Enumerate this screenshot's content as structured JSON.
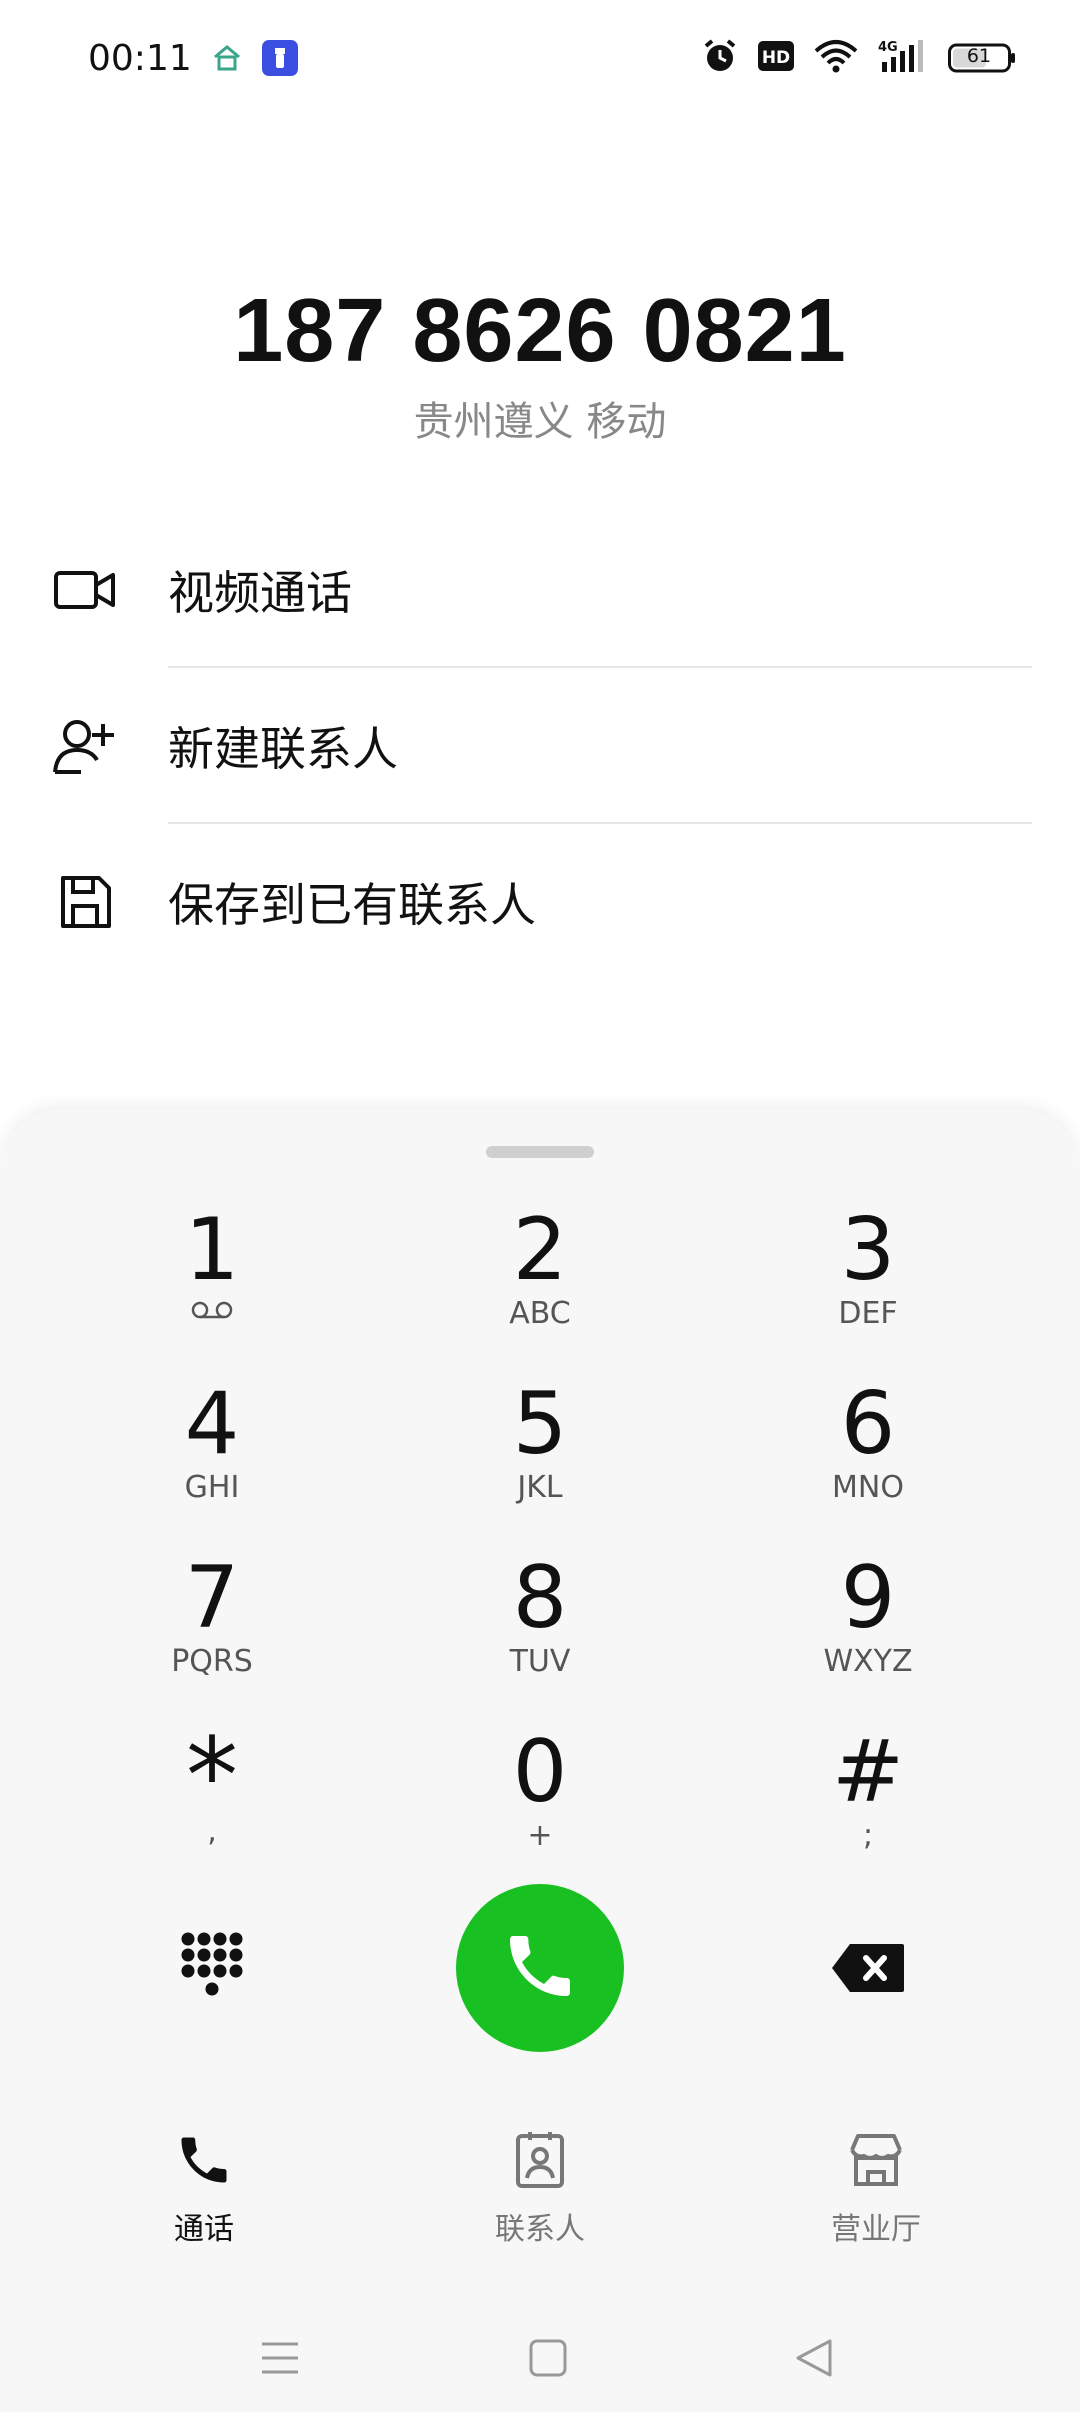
{
  "status_bar": {
    "time": "00:11",
    "battery": "61",
    "network": "4G"
  },
  "contact": {
    "number": "187 8626 0821",
    "location": "贵州遵义 移动"
  },
  "actions": [
    {
      "label": "视频通话",
      "icon": "video-call-icon"
    },
    {
      "label": "新建联系人",
      "icon": "add-contact-icon"
    },
    {
      "label": "保存到已有联系人",
      "icon": "save-icon"
    }
  ],
  "keypad": {
    "keys": [
      {
        "digit": "1",
        "letters": ""
      },
      {
        "digit": "2",
        "letters": "ABC"
      },
      {
        "digit": "3",
        "letters": "DEF"
      },
      {
        "digit": "4",
        "letters": "GHI"
      },
      {
        "digit": "5",
        "letters": "JKL"
      },
      {
        "digit": "6",
        "letters": "MNO"
      },
      {
        "digit": "7",
        "letters": "PQRS"
      },
      {
        "digit": "8",
        "letters": "TUV"
      },
      {
        "digit": "9",
        "letters": "WXYZ"
      },
      {
        "digit": "*",
        "letters": ","
      },
      {
        "digit": "0",
        "letters": "+"
      },
      {
        "digit": "#",
        "letters": ";"
      }
    ]
  },
  "bottom_nav": {
    "items": [
      {
        "label": "通话",
        "icon": "phone-icon",
        "active": true
      },
      {
        "label": "联系人",
        "icon": "contacts-icon",
        "active": false
      },
      {
        "label": "营业厅",
        "icon": "store-icon",
        "active": false
      }
    ]
  },
  "colors": {
    "call_green": "#19c022",
    "panel_bg": "#f7f7f7",
    "secondary_text": "#888888"
  }
}
